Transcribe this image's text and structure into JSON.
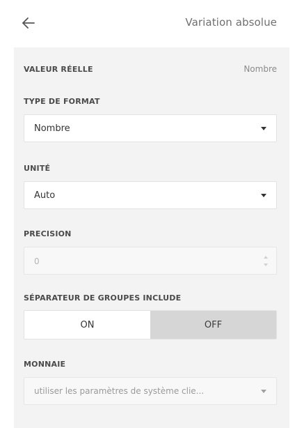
{
  "header": {
    "title": "Variation absolue",
    "back_icon": "arrow-left-icon"
  },
  "real_value": {
    "label": "VALEUR RÉELLE",
    "type": "Nombre"
  },
  "format_type": {
    "label": "TYPE DE FORMAT",
    "value": "Nombre"
  },
  "unit": {
    "label": "UNITÉ",
    "value": "Auto"
  },
  "precision": {
    "label": "PRECISION",
    "value": "0",
    "disabled": true
  },
  "group_separator": {
    "label": "SÉPARATEUR DE GROUPES INCLUDE",
    "on_label": "ON",
    "off_label": "OFF",
    "selected": "OFF"
  },
  "currency": {
    "label": "MONNAIE",
    "value": "utiliser les paramètres de système clie...",
    "disabled": true
  },
  "colors": {
    "panel_background": "#f3f3f3",
    "selected_toggle": "#d6d6d6",
    "text": "#333333",
    "muted_text": "#8a8a8a"
  }
}
